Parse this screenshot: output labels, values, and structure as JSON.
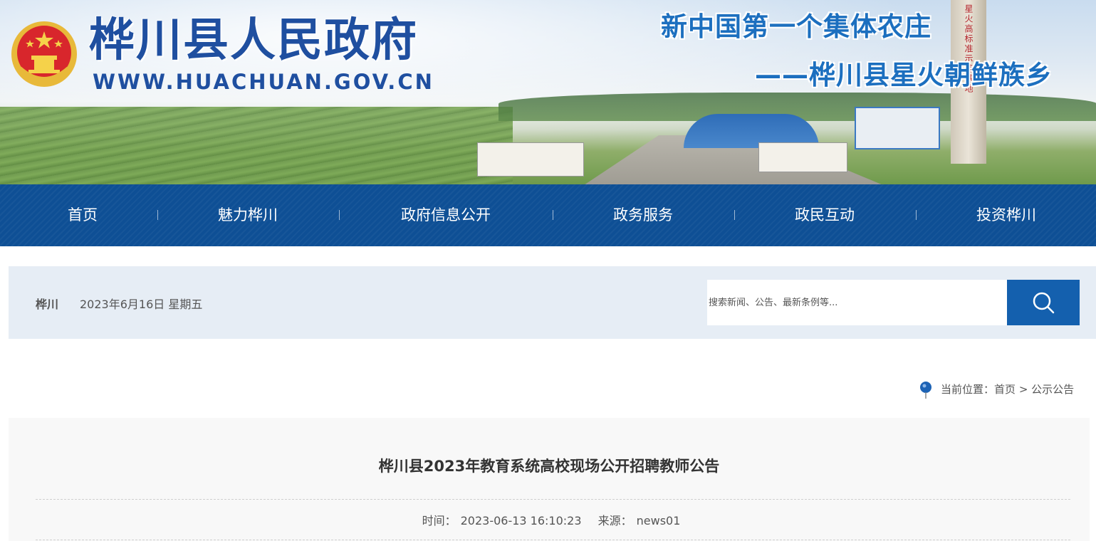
{
  "header": {
    "site_title": "桦川县人民政府",
    "site_url": "WWW.HUACHUAN.GOV.CN",
    "slogan_line1": "新中国第一个集体农庄",
    "slogan_line2": "——桦川县星火朝鲜族乡",
    "tower_text": "星火高标准示范基地"
  },
  "nav": {
    "items": [
      {
        "label": "首页"
      },
      {
        "label": "魅力桦川"
      },
      {
        "label": "政府信息公开"
      },
      {
        "label": "政务服务"
      },
      {
        "label": "政民互动"
      },
      {
        "label": "投资桦川"
      }
    ]
  },
  "infobar": {
    "city": "桦川",
    "date": "2023年6月16日 星期五",
    "search_placeholder": "搜索新闻、公告、最新条例等..."
  },
  "breadcrumb": {
    "prefix": "当前位置：",
    "home": "首页",
    "separator": ">",
    "current": "公示公告"
  },
  "article": {
    "title": "桦川县2023年教育系统高校现场公开招聘教师公告",
    "time_label": "时间：",
    "time_value": "2023-06-13 16:10:23",
    "source_label": "来源：",
    "source_value": "news01"
  },
  "colors": {
    "nav_bg": "#0e4f95",
    "search_button": "#1460ae",
    "infobar_bg": "#e6edf5",
    "title_blue": "#1f4fa0"
  },
  "icons": {
    "emblem": "national-emblem-icon",
    "search": "search-icon",
    "location": "location-pin-icon"
  }
}
